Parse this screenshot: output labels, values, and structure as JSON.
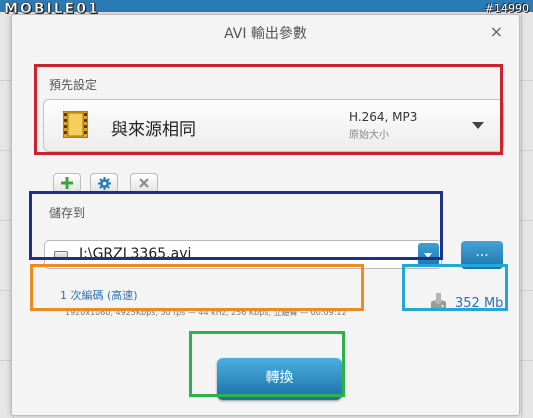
{
  "watermark": {
    "logo_text": "MOBILE01",
    "id": "#14990"
  },
  "dialog": {
    "title": "AVI 輸出參數",
    "close_glyph": "×"
  },
  "preset": {
    "label": "預先設定",
    "name": "與來源相同",
    "codec": "H.264, MP3",
    "subtitle": "原始大小",
    "icon": "film-icon"
  },
  "preset_actions": [
    {
      "name": "add",
      "icon": "plus-icon",
      "color": "#3aa53a"
    },
    {
      "name": "settings",
      "icon": "gear-icon",
      "color": "#2d79b8"
    },
    {
      "name": "delete",
      "icon": "close-icon",
      "color": "#8a8a8a"
    }
  ],
  "save_to": {
    "label": "儲存到",
    "path": "I:\\GRZL3365.avi",
    "browse_label": "...",
    "icon": "drive-icon"
  },
  "encoding": {
    "title": "1 次編碼 (高速)",
    "details": "1920x1080, 4925Kbps, 30 fps — 44 kHz, 256 Kbps, 立體聲 — 00:09:12"
  },
  "output_size": {
    "value": "352 Mb",
    "icon": "disk-size-icon"
  },
  "convert_button": {
    "label": "轉換"
  },
  "highlight_colors": {
    "preset": "#d0202e",
    "save_to": "#1e2f8c",
    "encoding": "#f08a1e",
    "size": "#22a8d6",
    "convert": "#2ab34a"
  },
  "accent_color": "#2a86c4"
}
